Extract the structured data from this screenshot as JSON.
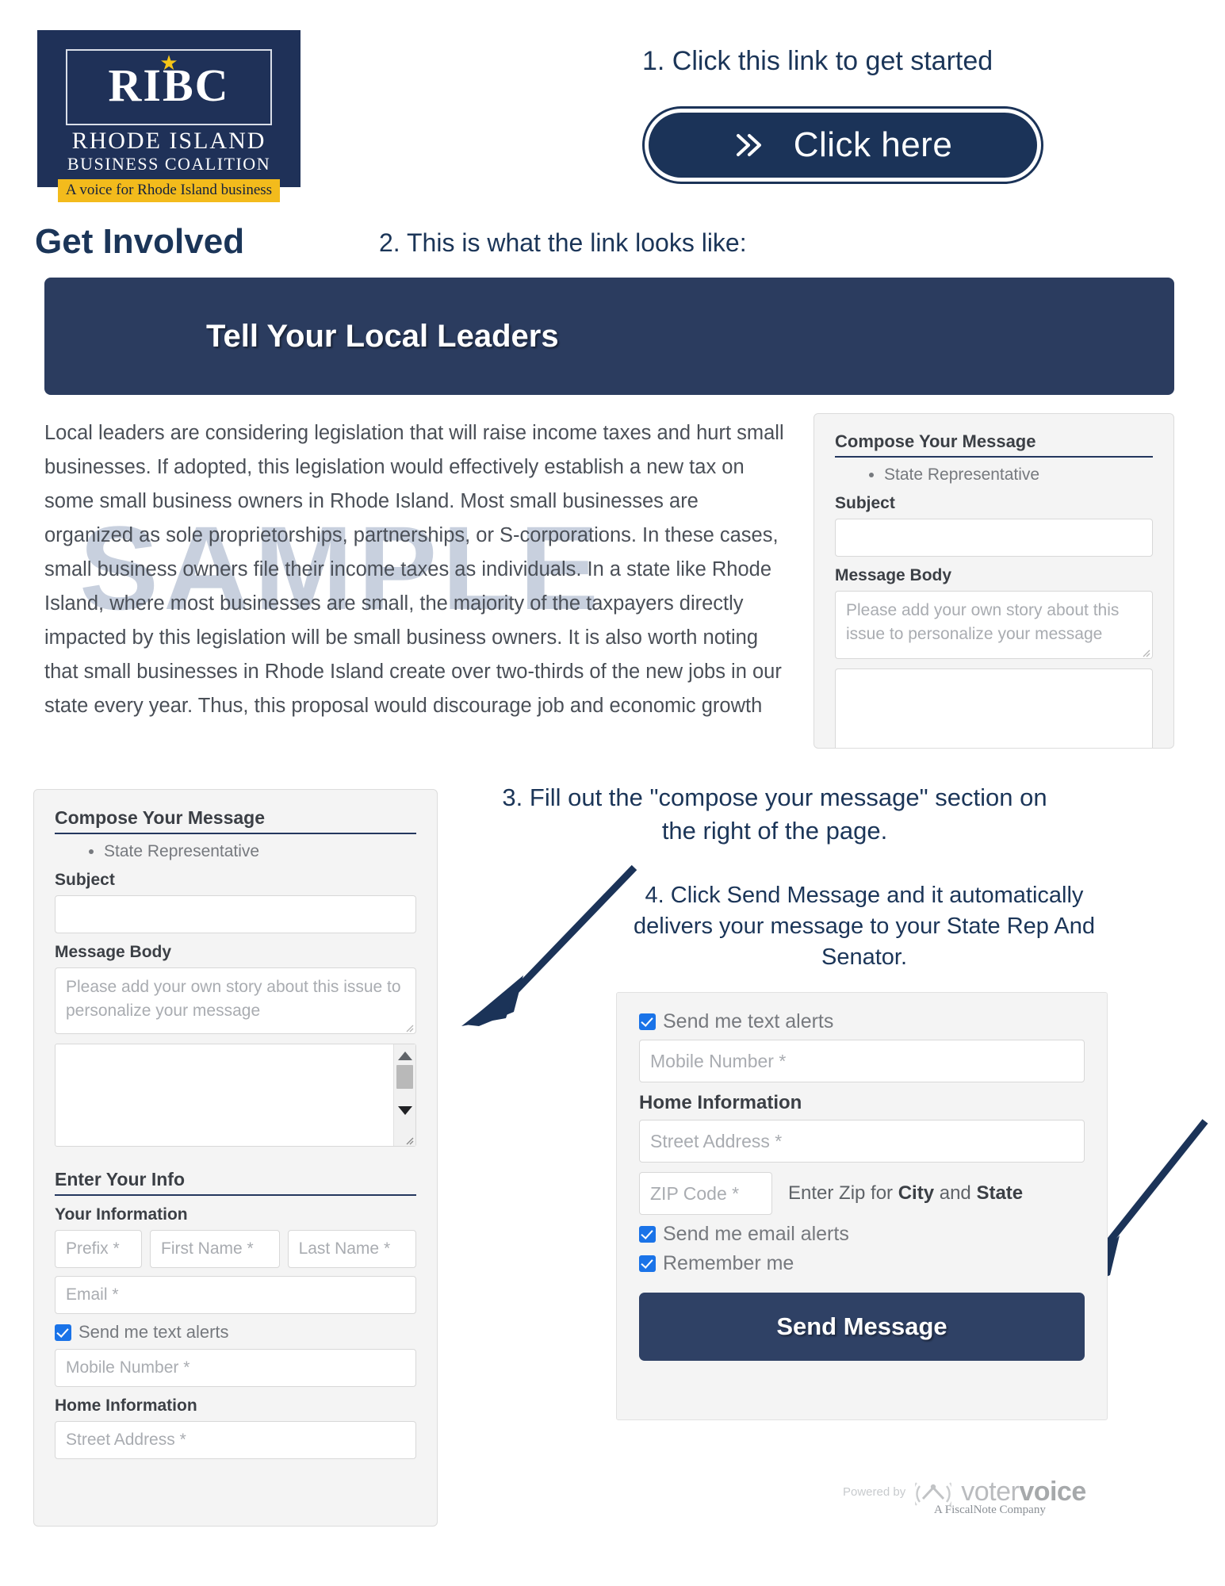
{
  "logo": {
    "star": "★",
    "acronym": "RIBC",
    "line1": "RHODE ISLAND",
    "line2": "BUSINESS COALITION",
    "tagline": "A voice for Rhode Island business"
  },
  "steps": {
    "step1": "1. Click this link to get started",
    "step2": "2. This is what the link looks like:",
    "step3": "3.  Fill out the \"compose your message\" section on the right of the page.",
    "step4": "4. Click Send Message and it automatically delivers your message to your State Rep And Senator."
  },
  "cta": {
    "label": "Click here",
    "icon": "double-chevron-right-icon"
  },
  "headings": {
    "get_involved": "Get Involved",
    "banner_title": "Tell Your Local Leaders"
  },
  "article": {
    "watermark": "SAMPLE",
    "body": "Local leaders are considering legislation that will raise income taxes and hurt small businesses.  If adopted, this legislation would effectively establish a new tax on some small business owners in Rhode Island.  Most small businesses are organized as sole proprietorships, partnerships, or S-corporations.  In these cases, small business owners file their income taxes as individuals.  In a state like Rhode Island, where most businesses are small, the majority of the taxpayers directly impacted by this legislation will be small business owners.  It is also worth noting that small businesses in Rhode Island create over two-thirds of the new jobs in our state every year. Thus, this proposal would discourage job and economic growth"
  },
  "compose": {
    "title": "Compose Your Message",
    "recipient": "State Representative",
    "subject_label": "Subject",
    "subject_value": "",
    "message_label": "Message Body",
    "message_placeholder": "Please add your own story about this issue to personalize your message",
    "extra_body_value": ""
  },
  "enter_info": {
    "title": "Enter Your Info",
    "your_information": "Your Information",
    "prefix_placeholder": "Prefix *",
    "first_name_placeholder": "First Name *",
    "last_name_placeholder": "Last Name *",
    "email_placeholder": "Email *",
    "text_alerts_label": "Send me text alerts",
    "mobile_placeholder": "Mobile Number *",
    "home_information": "Home Information",
    "street_placeholder": "Street Address *"
  },
  "form_right": {
    "text_alerts_label": "Send me text alerts",
    "mobile_placeholder": "Mobile Number *",
    "home_information": "Home Information",
    "street_placeholder": "Street Address *",
    "zip_placeholder": "ZIP Code *",
    "zip_hint_prefix": "Enter Zip for ",
    "zip_hint_city": "City",
    "zip_hint_and": " and ",
    "zip_hint_state": "State",
    "email_alerts_label": "Send me email alerts",
    "remember_me_label": "Remember me",
    "send_button": "Send Message"
  },
  "footer": {
    "powered_by": "Powered by",
    "brand_light": "voter",
    "brand_bold": "voice",
    "company": "A FiscalNote Company"
  },
  "colors": {
    "navy": "#1b3358",
    "banner_navy": "#2b3c5f",
    "gold": "#f3bb1c",
    "checkbox_blue": "#1a73e8",
    "panel_bg": "#f4f4f4"
  }
}
